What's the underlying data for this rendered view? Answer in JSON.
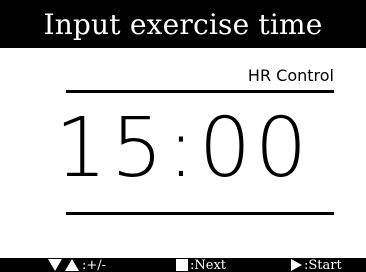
{
  "header": {
    "title": "Input exercise time"
  },
  "mode_label": "HR Control",
  "time_display": "15:00",
  "footer": {
    "adjust": {
      "icon": "up-down-triangle-icon",
      "label": ":+/-"
    },
    "next": {
      "icon": "square-icon",
      "label": ":Next"
    },
    "start": {
      "icon": "play-triangle-icon",
      "label": ":Start"
    }
  },
  "colors": {
    "background": "#ffffff",
    "foreground": "#000000",
    "bar": "#000000",
    "bar_text": "#ffffff"
  }
}
